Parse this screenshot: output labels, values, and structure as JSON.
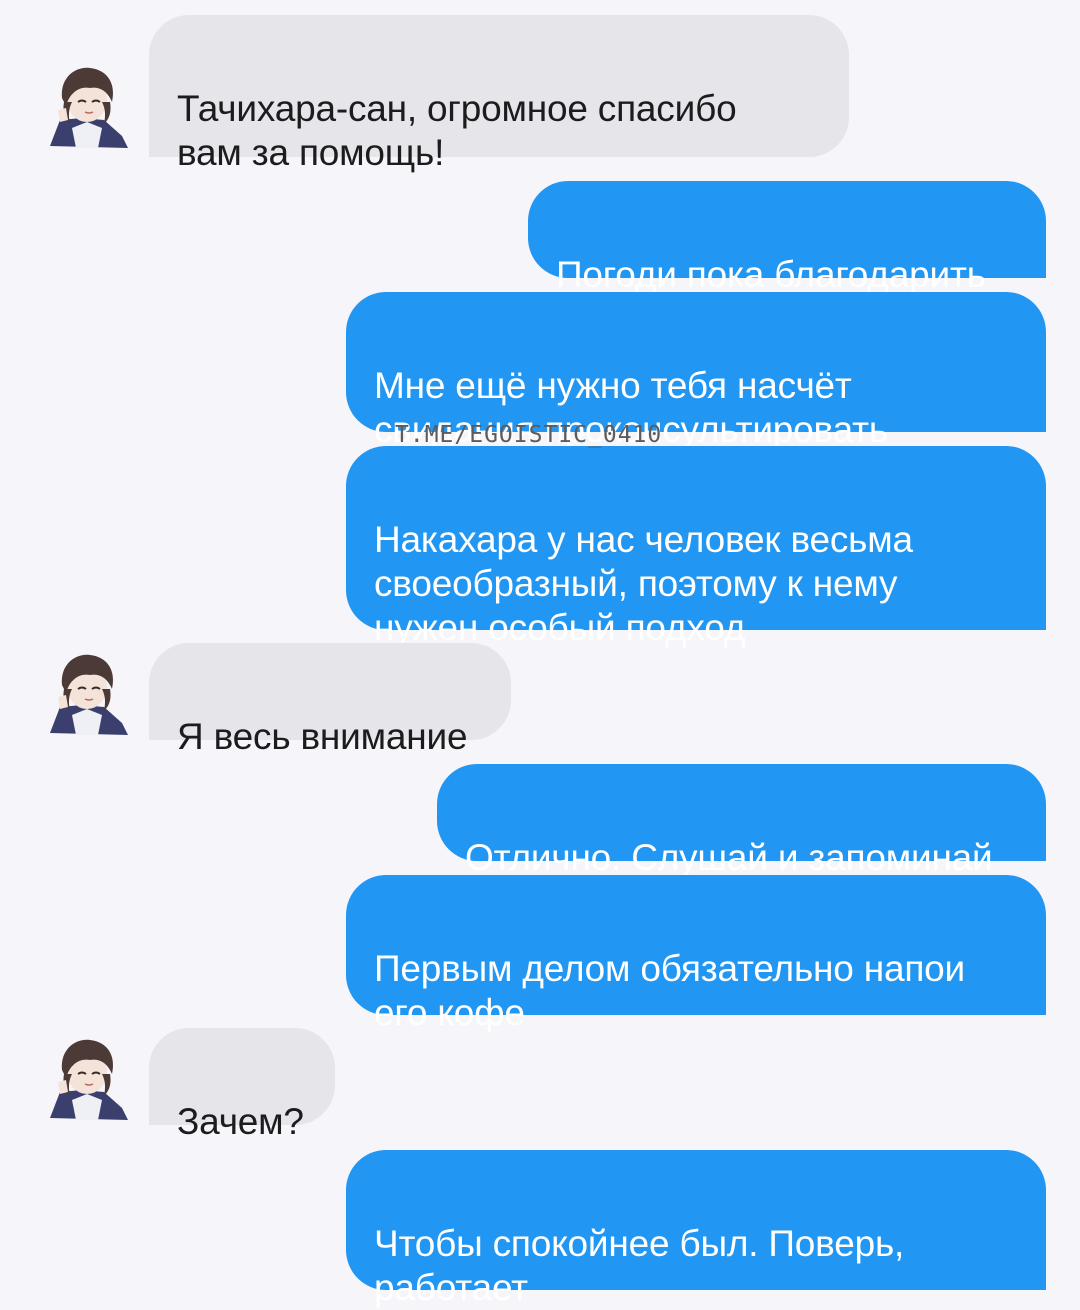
{
  "watermark": "T.ME/EGOISTIC_0410",
  "messages": [
    {
      "side": "in",
      "text": "Тачихара-сан, огромное спасибо\nвам за помощь!"
    },
    {
      "side": "out",
      "text": "Погоди пока благодарить"
    },
    {
      "side": "out",
      "text": "Мне ещё нужно тебя насчёт\nсвидания проконсультировать"
    },
    {
      "side": "out",
      "text": "Накахара у нас человек весьма\nсвоеобразный, поэтому к нему\nнужен особый подход"
    },
    {
      "side": "in",
      "text": "Я весь внимание"
    },
    {
      "side": "out",
      "text": "Отлично. Слушай и запоминай"
    },
    {
      "side": "out",
      "text": "Первым делом обязательно напои\nего кофе"
    },
    {
      "side": "in",
      "text": "Зачем?"
    },
    {
      "side": "out",
      "text": "Чтобы спокойнее был. Поверь,\nработает"
    }
  ]
}
